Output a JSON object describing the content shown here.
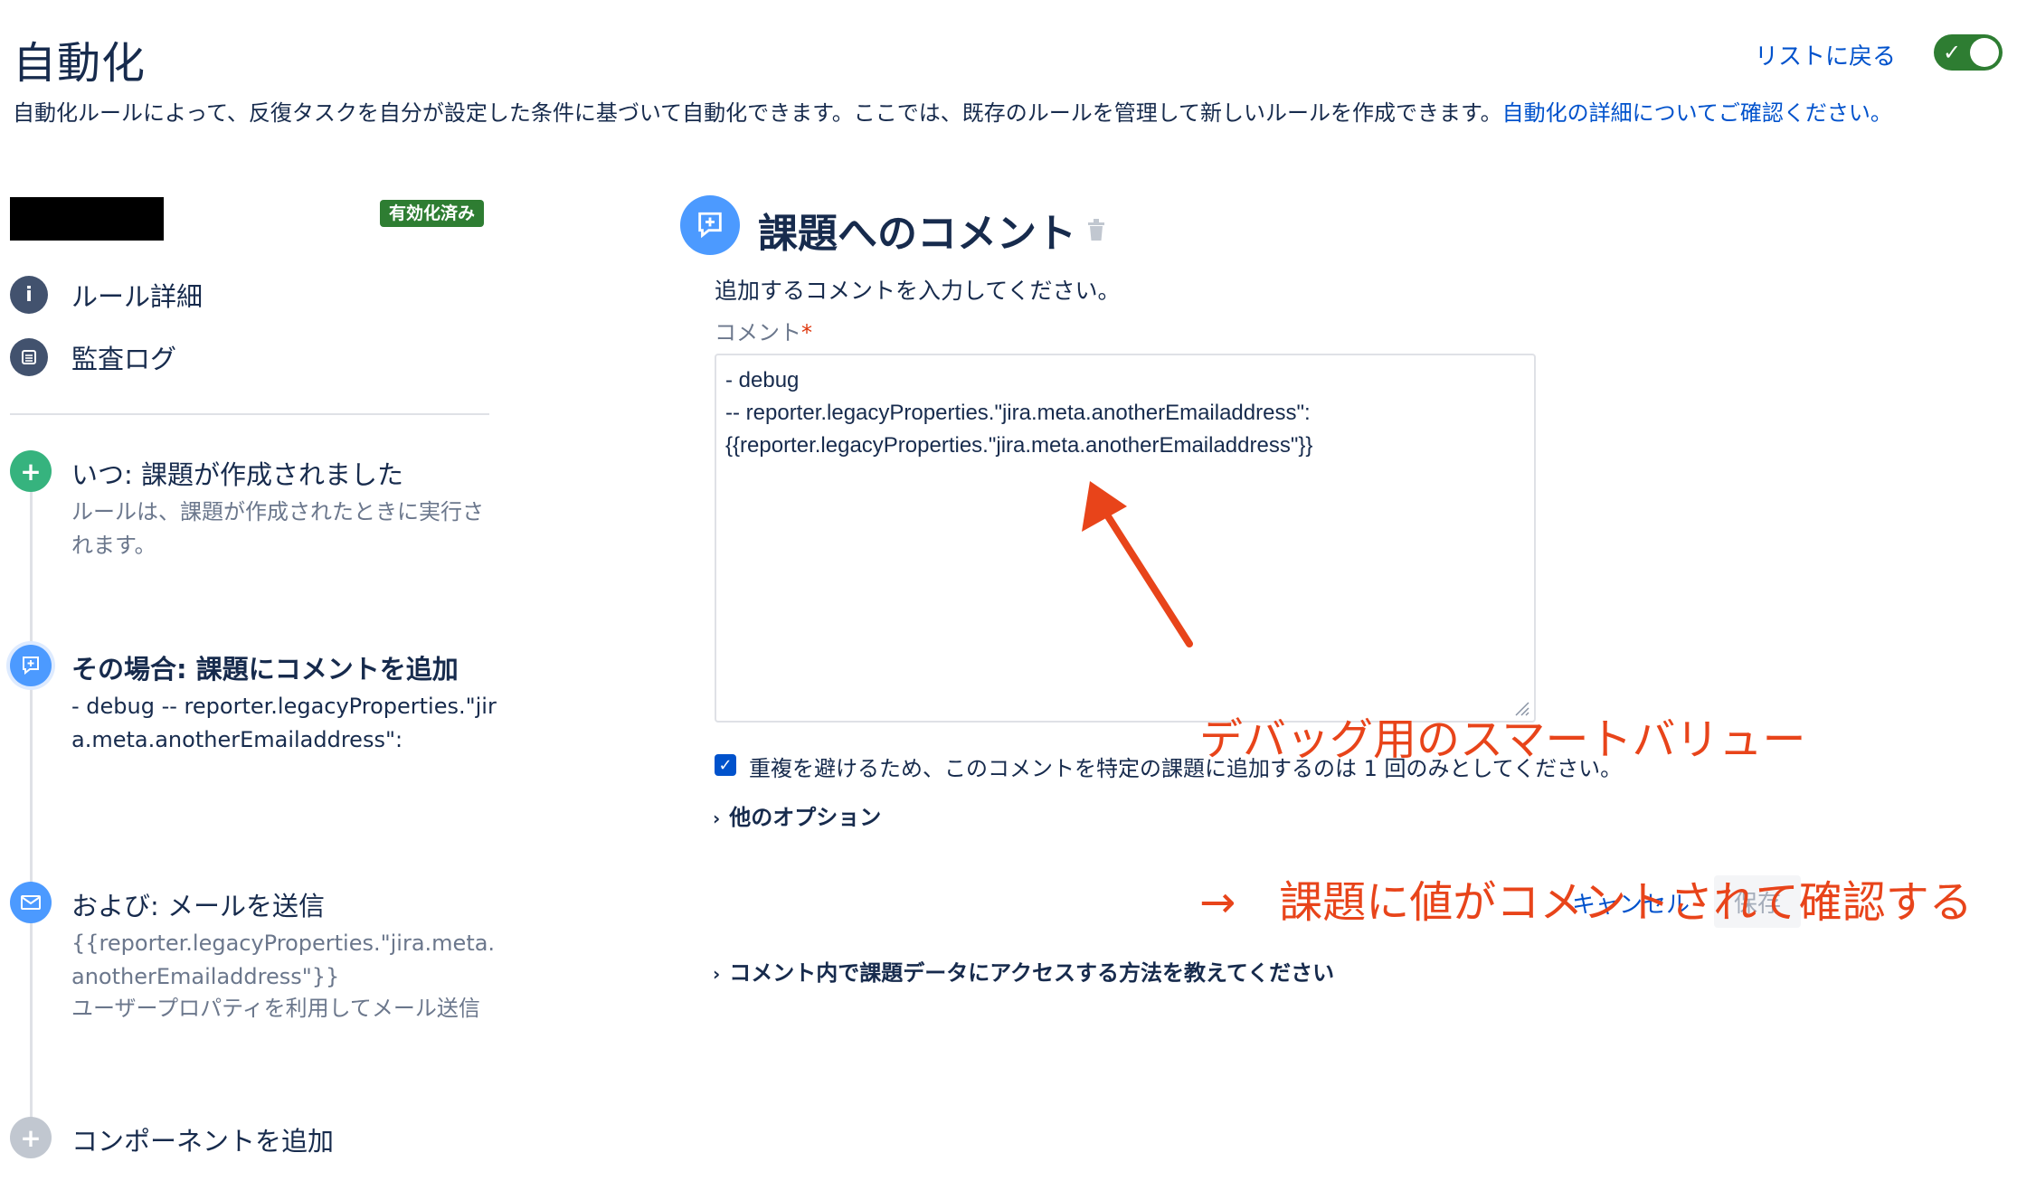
{
  "header": {
    "title": "自動化",
    "back_link": "リストに戻る",
    "toggle_state": "on"
  },
  "description": {
    "text": "自動化ルールによって、反復タスクを自分が設定した条件に基づいて自動化できます。ここでは、既存のルールを管理して新しいルールを作成できます。",
    "link": "自動化の詳細についてご確認ください。"
  },
  "sidebar": {
    "badge": "有効化済み",
    "nav": [
      {
        "label": "ルール詳細",
        "icon": "info-icon"
      },
      {
        "label": "監査ログ",
        "icon": "list-icon"
      }
    ],
    "steps": [
      {
        "title": "いつ: 課題が作成されました",
        "desc": "ルールは、課題が作成されたときに実行されます。",
        "icon": "plus-icon",
        "color": "#36b37e"
      },
      {
        "title": "その場合: 課題にコメントを追加",
        "desc": "- debug -- reporter.legacyProperties.\"jira.meta.anotherEmailaddress\":",
        "icon": "comment-icon",
        "color": "#4c9aff"
      },
      {
        "title": "および: メールを送信",
        "desc": "{{reporter.legacyProperties.\"jira.meta.anotherEmailaddress\"}}",
        "desc2": "ユーザープロパティを利用してメール送信",
        "icon": "mail-icon",
        "color": "#4c9aff"
      },
      {
        "title": "コンポーネントを追加",
        "icon": "plus-icon",
        "color": "#c1c7d0"
      }
    ]
  },
  "panel": {
    "title": "課題へのコメント",
    "instruction": "追加するコメントを入力してください。",
    "field_label": "コメント",
    "required_mark": "*",
    "comment_lines": [
      "- debug",
      "-- reporter.legacyProperties.\"jira.meta.anotherEmailaddress\":",
      "{{reporter.legacyProperties.\"jira.meta.anotherEmailaddress\"}}"
    ],
    "checkbox_label": "重複を避けるため、このコメントを特定の課題に追加するのは 1 回のみとしてください。",
    "checkbox_checked": true,
    "more_options": "他のオプション",
    "cancel": "キャンセル",
    "save": "保存",
    "help_expander": "コメント内で課題データにアクセスする方法を教えてください"
  },
  "annotation": {
    "line1": "デバッグ用のスマートバリュー",
    "line2": "→　課題に値がコメントされて確認する",
    "color": "#e8441a"
  }
}
